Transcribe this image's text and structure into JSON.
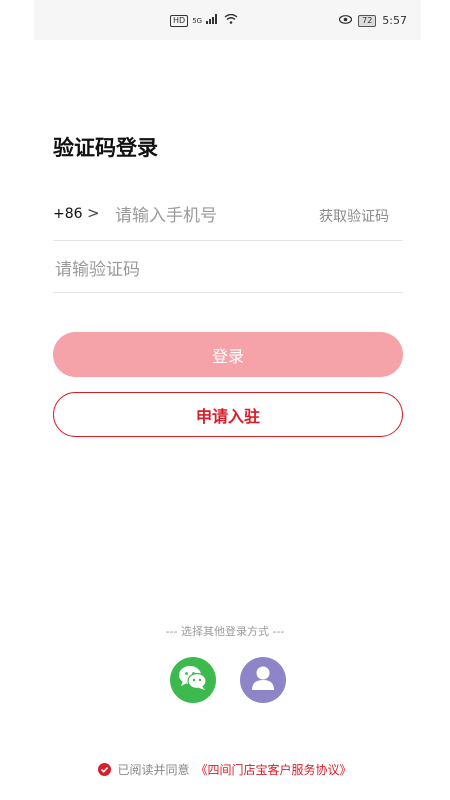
{
  "status_bar": {
    "network_badge": "HD",
    "network_type": "5G",
    "battery": "72",
    "time": "5:57"
  },
  "page": {
    "title": "验证码登录"
  },
  "phone": {
    "country_code": "+86",
    "chevron": ">",
    "placeholder": "请输入手机号",
    "value": "",
    "get_code_label": "获取验证码"
  },
  "code": {
    "placeholder": "请输验证码",
    "value": ""
  },
  "buttons": {
    "login_label": "登录",
    "apply_label": "申请入驻"
  },
  "other_login": {
    "label": "--- 选择其他登录方式 ---"
  },
  "agreement": {
    "text": "已阅读并同意",
    "link": "《四间门店宝客户服务协议》"
  },
  "colors": {
    "accent": "#d91e2b",
    "login_button_bg": "#f5a2a8",
    "wechat": "#3dba4e",
    "account": "#8e85c9"
  },
  "icons": {
    "wechat": "wechat-icon",
    "account": "user-icon",
    "check": "check-icon"
  }
}
